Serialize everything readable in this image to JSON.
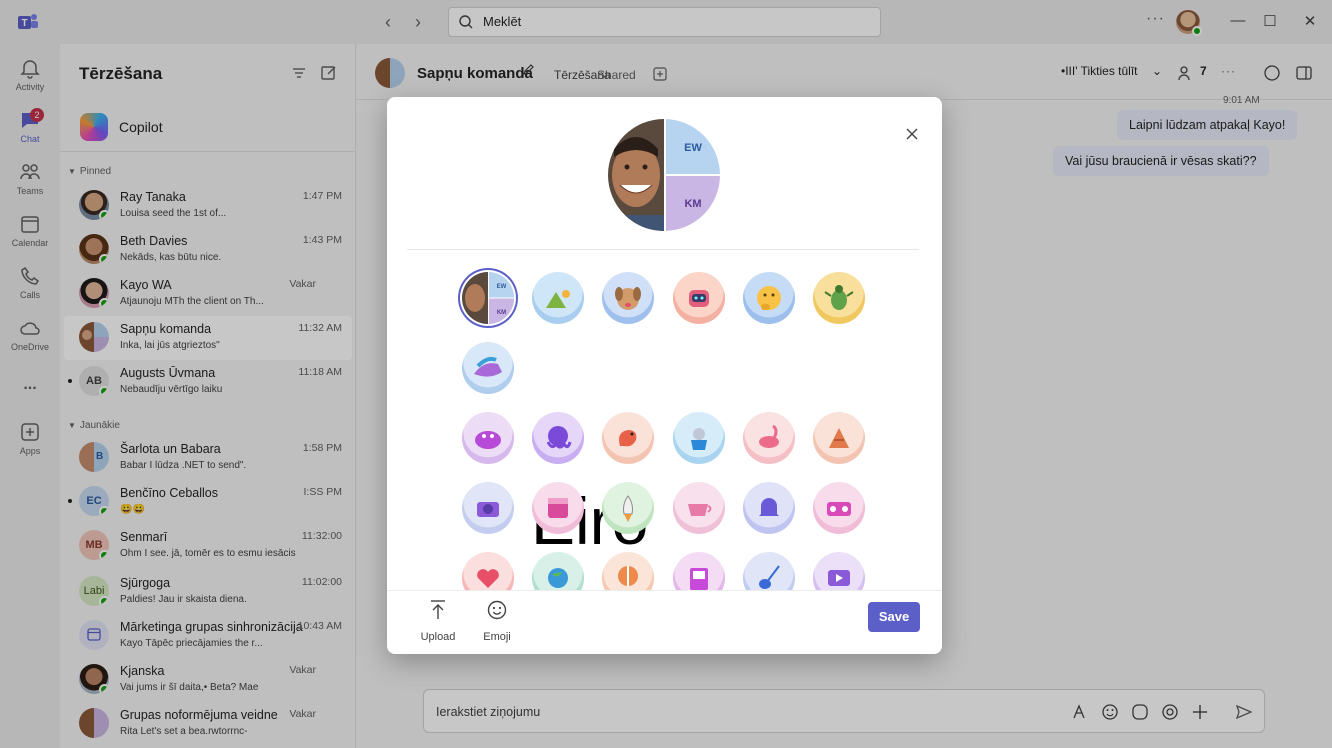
{
  "search": {
    "placeholder": "Meklēt"
  },
  "rail": {
    "items": [
      {
        "label": "Activity"
      },
      {
        "label": "Chat",
        "badge": "2"
      },
      {
        "label": "Teams"
      },
      {
        "label": "Calendar"
      },
      {
        "label": "Calls"
      },
      {
        "label": "OneDrive"
      },
      {
        "label": "..."
      },
      {
        "label": "Apps"
      }
    ]
  },
  "chatlist": {
    "title": "Tērzēšana",
    "copilot": "Copilot",
    "pinned_header": "Pinned",
    "recent_header": "Jaunākie",
    "pinned": [
      {
        "name": "Ray Tanaka",
        "preview": "Louisa seed the 1st                    of...",
        "time": "1:47 PM"
      },
      {
        "name": "Beth Davies",
        "preview": "Nekāds, kas būtu                    nice.",
        "time": "1:43 PM"
      },
      {
        "name": "Kayo WA",
        "preview": "Atjaunoju MTh          the client on Th...",
        "time": "Vakar"
      },
      {
        "name": "Sapņu komanda",
        "preview": "Inka, lai jūs atgrieztos\"",
        "time": "11:32 AM"
      },
      {
        "name": "Augusts Ūvmana",
        "preview": "Nebaudīju vērtīgo laiku",
        "time": "11:18 AM",
        "initials": "AB"
      }
    ],
    "recent": [
      {
        "name": "Šarlota un Babara",
        "preview": "Babar I lūdza .NET to send\".",
        "time": "1:58 PM"
      },
      {
        "name": "Benčīno Ceballos",
        "preview": "😀😀",
        "time": "I:SS PM",
        "initials": "EC"
      },
      {
        "name": "Senmarī",
        "preview": "Ohm I see. jā, tomēr es to esmu iesācis",
        "time": "11:32:00",
        "initials": "MB"
      },
      {
        "name": "Sjūrgoga",
        "preview": "Paldies! Jau ir skaista diena.",
        "time": "11:02:00",
        "initials": "Labi"
      },
      {
        "name": "Mārketinga grupas sinhronizācija",
        "preview": "Kayo  Tāpēc priecājamies        the r...",
        "time": "10:43 AM"
      },
      {
        "name": "Kjanska",
        "preview": "Vai jums ir šī daita,• Beta? Mae",
        "time": "Vakar"
      },
      {
        "name": "Grupas noformējuma veidne",
        "preview": "Rita Let's set a bea.rwtorrnc-",
        "time": "Vakar"
      }
    ]
  },
  "main": {
    "title": "Sapņu komanda",
    "tab_chat": "Tērzēšana",
    "tab_shared": "Shared",
    "meeting": "•III' Tikties tūlīt",
    "participants": "7",
    "time_stamp": "9:01 AM",
    "messages": [
      "Laipni lūdzam atpakaļ Kayo!",
      "Vai jūsu braucienā ir vēsas skati??"
    ],
    "compose_placeholder": "Ierakstiet ziņojumu"
  },
  "dialog": {
    "preview_initials": [
      "EW",
      "KM"
    ],
    "tile_initials": [
      "EW",
      "KM"
    ],
    "overlay_label": "Eiro",
    "upload_label": "Upload",
    "emoji_label": "Emoji",
    "save_label": "Save"
  },
  "colors": {
    "accent": "#5b5fc7",
    "badge": "#c4314b",
    "presence": "#13a10e",
    "bubble": "#e8ebfa"
  }
}
